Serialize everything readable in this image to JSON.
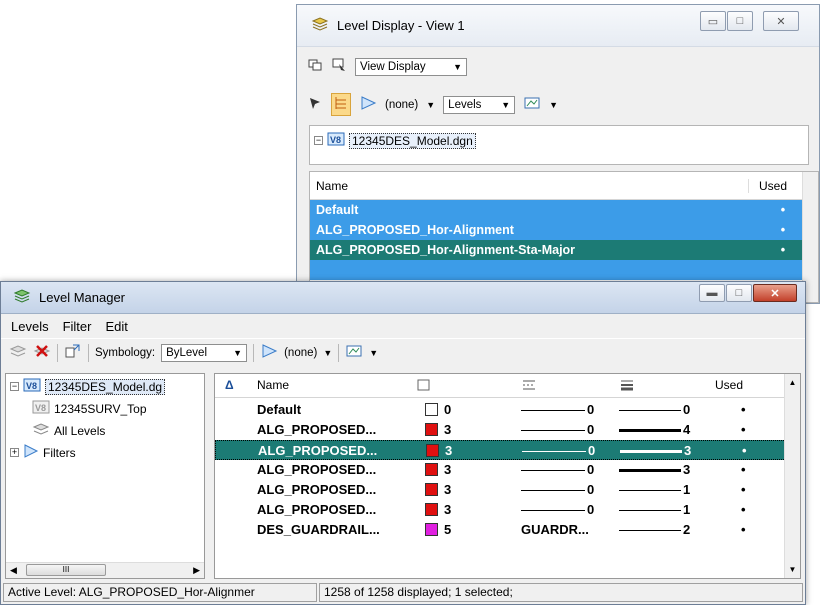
{
  "level_display": {
    "title": "Level Display - View 1",
    "view_mode": "View Display",
    "filter_none": "(none)",
    "levels_mode": "Levels",
    "tree_root": "12345DES_Model.dgn",
    "col_name": "Name",
    "col_used": "Used",
    "rows": [
      {
        "name": "Default",
        "used": "•",
        "style": "blue"
      },
      {
        "name": "ALG_PROPOSED_Hor-Alignment",
        "used": "•",
        "style": "blue"
      },
      {
        "name": "ALG_PROPOSED_Hor-Alignment-Sta-Major",
        "used": "•",
        "style": "teal"
      }
    ]
  },
  "level_manager": {
    "title": "Level Manager",
    "menu": [
      "Levels",
      "Filter",
      "Edit"
    ],
    "symbology_label": "Symbology:",
    "symbology_value": "ByLevel",
    "filter_none": "(none)",
    "tree": {
      "root": "12345DES_Model.dg",
      "child": "12345SURV_Top",
      "all_levels": "All Levels",
      "filters": "Filters"
    },
    "scroll_thumb": "III",
    "columns": {
      "sort": "Δ",
      "name": "Name",
      "used": "Used"
    },
    "rows": [
      {
        "name": "Default",
        "color": "#ffffff",
        "color_num": "0",
        "style_val": "0",
        "weight_val": "0",
        "weight": "thin"
      },
      {
        "name": "ALG_PROPOSED...",
        "color": "#e01010",
        "color_num": "3",
        "style_val": "0",
        "weight_val": "4",
        "weight": "thick"
      },
      {
        "name": "ALG_PROPOSED...",
        "color": "#e01010",
        "color_num": "3",
        "style_val": "0",
        "weight_val": "3",
        "weight": "thick",
        "selected": true
      },
      {
        "name": "ALG_PROPOSED...",
        "color": "#e01010",
        "color_num": "3",
        "style_val": "0",
        "weight_val": "3",
        "weight": "thick"
      },
      {
        "name": "ALG_PROPOSED...",
        "color": "#e01010",
        "color_num": "3",
        "style_val": "0",
        "weight_val": "1",
        "weight": "thin"
      },
      {
        "name": "ALG_PROPOSED...",
        "color": "#e01010",
        "color_num": "3",
        "style_val": "0",
        "weight_val": "1",
        "weight": "thin"
      },
      {
        "name": "DES_GUARDRAIL...",
        "color": "#e020e0",
        "color_num": "5",
        "style_val": "GUARDR...",
        "weight_val": "2",
        "weight": "thin"
      }
    ],
    "used_mark": "•",
    "status_active": "Active Level: ALG_PROPOSED_Hor-Alignmer",
    "status_count": "1258 of 1258 displayed; 1 selected;"
  },
  "colors": {
    "selection_blue": "#3c9ce8",
    "selection_teal": "#1c7b75"
  }
}
